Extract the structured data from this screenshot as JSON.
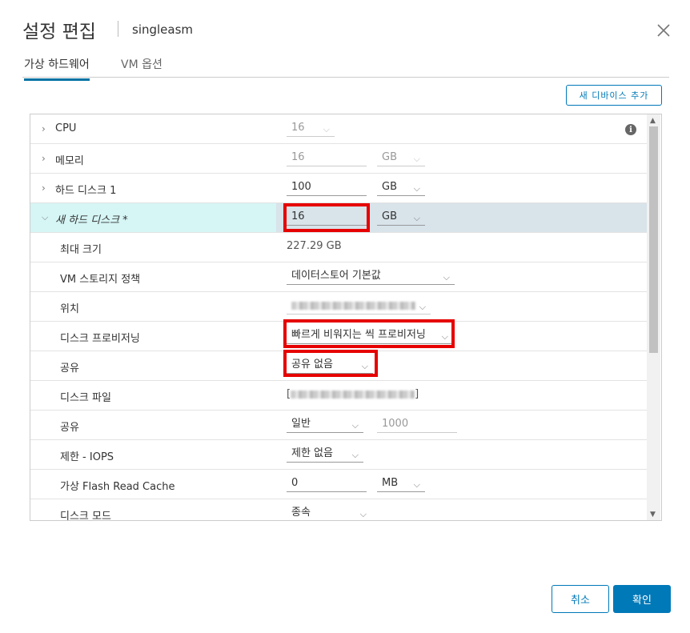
{
  "dialog": {
    "title": "설정 편집",
    "subtitle": "singleasm",
    "tabs": [
      "가상 하드웨어",
      "VM 옵션"
    ],
    "add_device_label": "새 디바이스 추가",
    "cancel_label": "취소",
    "ok_label": "확인"
  },
  "rows": {
    "cpu": {
      "label": "CPU",
      "value": "16"
    },
    "memory": {
      "label": "메모리",
      "value": "16",
      "unit": "GB"
    },
    "hdd1": {
      "label": "하드 디스크 1",
      "value": "100",
      "unit": "GB"
    },
    "new_disk": {
      "label": "새 하드 디스크 *",
      "value": "16",
      "unit": "GB"
    },
    "max_size": {
      "label": "최대 크기",
      "value": "227.29 GB"
    },
    "storage_policy": {
      "label": "VM 스토리지 정책",
      "value": "데이터스토어 기본값"
    },
    "location": {
      "label": "위치"
    },
    "provisioning": {
      "label": "디스크 프로비저닝",
      "value": "빠르게 비워지는 씩 프로비저닝"
    },
    "sharing": {
      "label": "공유",
      "value": "공유 없음"
    },
    "disk_file": {
      "label": "디스크 파일",
      "open": "[",
      "close": "]"
    },
    "shares": {
      "label": "공유",
      "value": "일반",
      "number": "1000"
    },
    "limit_iops": {
      "label": "제한 - IOPS",
      "value": "제한 없음"
    },
    "flash_cache": {
      "label": "가상 Flash Read Cache",
      "value": "0",
      "unit": "MB"
    },
    "disk_mode": {
      "label": "디스크 모드",
      "value": "종속"
    }
  },
  "colors": {
    "accent": "#0079b8",
    "highlight": "#e60000",
    "selected_row": "#d8e3ea"
  }
}
